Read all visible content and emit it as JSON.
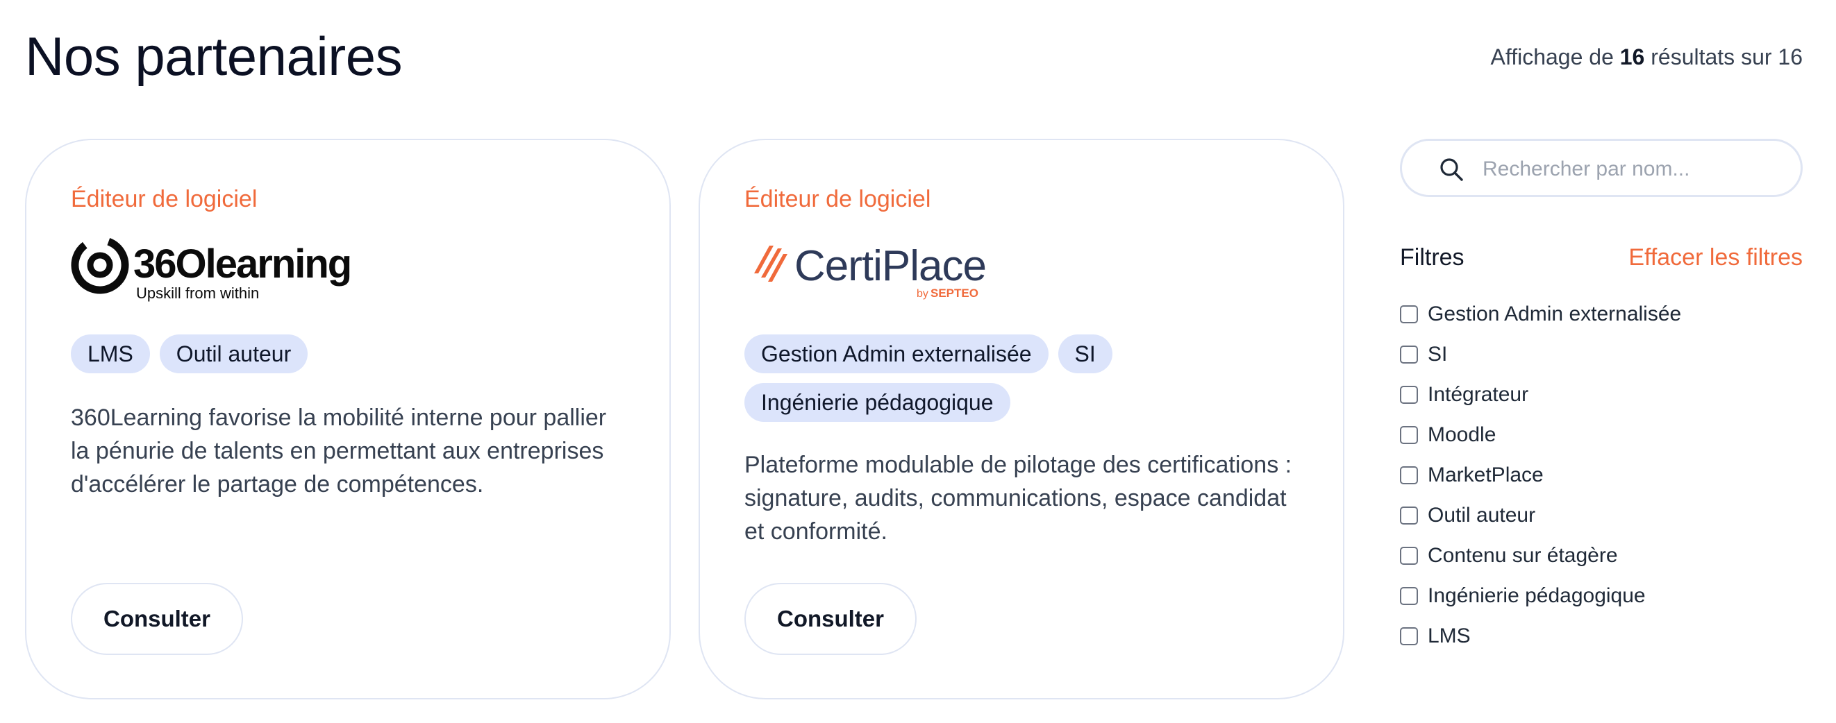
{
  "page": {
    "title": "Nos partenaires",
    "results": {
      "prefix": "Affichage de",
      "shown": "16",
      "middle": "résultats sur",
      "total": "16"
    }
  },
  "cards": [
    {
      "category": "Éditeur de logiciel",
      "logo": {
        "name": "360learning-logo",
        "wordmark": "36Olearning",
        "tagline": "Upskill from within"
      },
      "tags": [
        "LMS",
        "Outil auteur"
      ],
      "description": "360Learning favorise la mobilité interne pour pallier la pénurie de talents en permettant aux entreprises d'accélérer le partage de compétences.",
      "button_label": "Consulter"
    },
    {
      "category": "Éditeur de logiciel",
      "logo": {
        "name": "certiplace-logo",
        "wordmark": "CertiPlace",
        "byline_prefix": "by",
        "byline_brand": "SEPTEO"
      },
      "tags": [
        "Gestion Admin externalisée",
        "SI",
        "Ingénierie pédagogique"
      ],
      "description": "Plateforme modulable de pilotage des certifications : signature, audits, communications, espace candidat et conformité.",
      "button_label": "Consulter"
    }
  ],
  "search": {
    "placeholder": "Rechercher par nom...",
    "value": ""
  },
  "filters": {
    "title": "Filtres",
    "clear_label": "Effacer les filtres",
    "options": [
      "Gestion Admin externalisée",
      "SI",
      "Intégrateur",
      "Moodle",
      "MarketPlace",
      "Outil auteur",
      "Contenu sur étagère",
      "Ingénierie pédagogique",
      "LMS"
    ]
  },
  "colors": {
    "accent": "#f06a3b",
    "tag_bg": "#dce4fb",
    "border": "#dfe5f3",
    "certiplace_navy": "#2e3a59",
    "septeo_orange": "#f06a3b"
  }
}
